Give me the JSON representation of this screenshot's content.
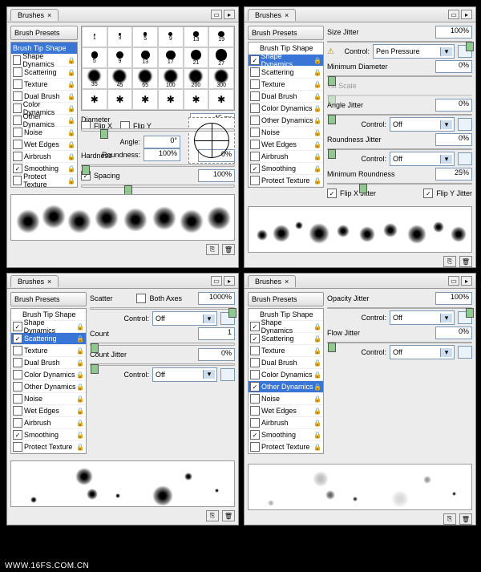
{
  "watermark": "WWW.16FS.COM.CN",
  "common": {
    "tab": "Brushes",
    "presets_btn": "Brush Presets",
    "tip": "Brush Tip Shape",
    "items": [
      "Shape Dynamics",
      "Scattering",
      "Texture",
      "Dual Brush",
      "Color Dynamics",
      "Other Dynamics",
      "Noise",
      "Wet Edges",
      "Airbrush",
      "Smoothing",
      "Protect Texture"
    ]
  },
  "p1": {
    "sel": "tip",
    "checks": [
      false,
      false,
      false,
      false,
      false,
      false,
      false,
      false,
      false,
      true,
      false
    ],
    "sizes": [
      "1",
      "3",
      "5",
      "9",
      "13",
      "19",
      "5",
      "9",
      "13",
      "17",
      "21",
      "27",
      "35",
      "45",
      "65",
      "100",
      "200",
      "300"
    ],
    "diameter_lbl": "Diameter",
    "diameter": "45 px",
    "flipx": "Flip X",
    "flipy": "Flip Y",
    "angle_lbl": "Angle:",
    "angle": "0°",
    "round_lbl": "Roundness:",
    "round": "100%",
    "hard_lbl": "Hardness",
    "hard": "0%",
    "spacing_lbl": "Spacing",
    "spacing": "100%"
  },
  "p2": {
    "sel": 0,
    "checks": [
      true,
      false,
      false,
      false,
      false,
      false,
      false,
      false,
      false,
      true,
      false
    ],
    "sj_lbl": "Size Jitter",
    "sj": "100%",
    "ctrl_lbl": "Control:",
    "ctrl": "Pen Pressure",
    "md_lbl": "Minimum Diameter",
    "md": "0%",
    "ts_lbl": "Tilt Scale",
    "aj_lbl": "Angle Jitter",
    "aj": "0%",
    "aj_ctrl": "Off",
    "rj_lbl": "Roundness Jitter",
    "rj": "0%",
    "rj_ctrl": "Off",
    "mr_lbl": "Minimum Roundness",
    "mr": "25%",
    "fxj": "Flip X Jitter",
    "fyj": "Flip Y Jitter"
  },
  "p3": {
    "sel": 1,
    "checks": [
      true,
      true,
      false,
      false,
      false,
      false,
      false,
      false,
      false,
      true,
      false
    ],
    "sc_lbl": "Scatter",
    "ba": "Both Axes",
    "sc": "1000%",
    "sc_ctrl": "Off",
    "ctrl_lbl": "Control:",
    "ct_lbl": "Count",
    "ct": "1",
    "cj_lbl": "Count Jitter",
    "cj": "0%",
    "cj_ctrl": "Off"
  },
  "p4": {
    "sel": 5,
    "checks": [
      true,
      true,
      false,
      false,
      false,
      true,
      false,
      false,
      false,
      true,
      false
    ],
    "oj_lbl": "Opacity Jitter",
    "oj": "100%",
    "oj_ctrl": "Off",
    "ctrl_lbl": "Control:",
    "fj_lbl": "Flow Jitter",
    "fj": "0%",
    "fj_ctrl": "Off"
  }
}
